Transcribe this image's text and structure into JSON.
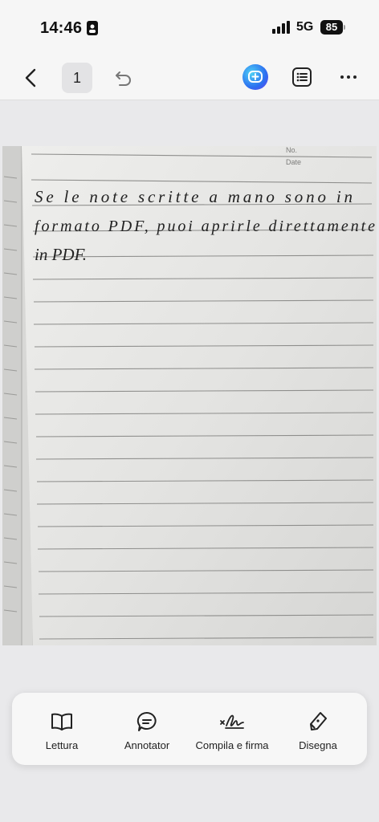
{
  "status_bar": {
    "time": "14:46",
    "network": "5G",
    "battery": "85"
  },
  "toolbar": {
    "page_number": "1",
    "back_icon": "chevron-left-icon",
    "undo_icon": "undo-icon",
    "ai_icon": "ai-assistant-icon",
    "outline_icon": "list-icon",
    "more_icon": "more-icon"
  },
  "document": {
    "header_labels": [
      "No.",
      "Date"
    ],
    "handwriting": [
      "Se le note scritte a mano sono in",
      "formato PDF, puoi aprirle direttamente",
      "in PDF."
    ]
  },
  "bottom_bar": {
    "items": [
      {
        "label": "Lettura",
        "icon": "book-icon"
      },
      {
        "label": "Annotator",
        "icon": "comment-icon"
      },
      {
        "label": "Compila e firma",
        "icon": "signature-icon"
      },
      {
        "label": "Disegna",
        "icon": "pen-icon"
      }
    ]
  },
  "colors": {
    "accent": "#2c6ff0",
    "toolbar_bg": "#f6f6f6",
    "page_bg": "#e9e9eb"
  }
}
